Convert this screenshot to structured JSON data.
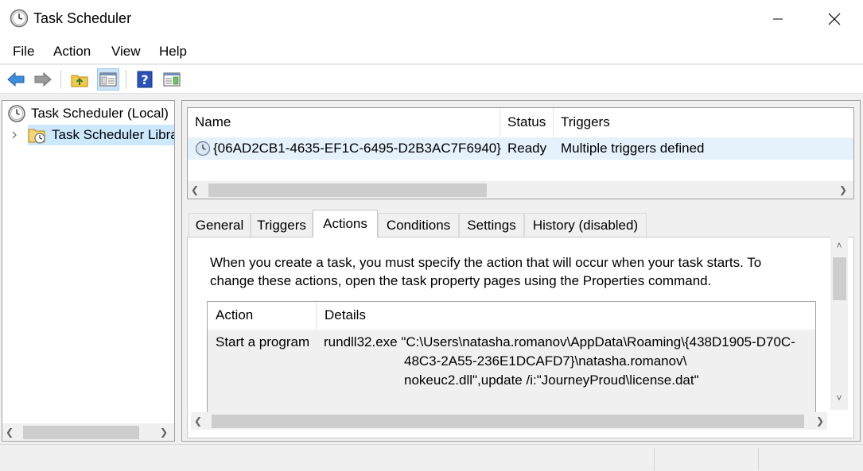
{
  "window": {
    "title": "Task Scheduler"
  },
  "menu": [
    "File",
    "Action",
    "View",
    "Help"
  ],
  "toolbar": {
    "icons": [
      "back-arrow-icon",
      "forward-arrow-icon",
      "folder-up-icon",
      "show-hide-console-tree-icon",
      "help-icon",
      "show-hide-action-pane-icon"
    ]
  },
  "tree": {
    "root": "Task Scheduler (Local)",
    "library": "Task Scheduler Library"
  },
  "task_list": {
    "columns": [
      "Name",
      "Status",
      "Triggers"
    ],
    "rows": [
      {
        "name": "{06AD2CB1-4635-EF1C-6495-D2B3AC7F6940}",
        "status": "Ready",
        "triggers": "Multiple triggers defined"
      }
    ]
  },
  "tabs": [
    "General",
    "Triggers",
    "Actions",
    "Conditions",
    "Settings",
    "History (disabled)"
  ],
  "active_tab": "Actions",
  "actions_tab": {
    "description_line1": "When you create a task, you must specify the action that will occur when your task starts.  To",
    "description_line2": "change  these  actions, open the task property pages using the Properties command.",
    "columns": [
      "Action",
      "Details"
    ],
    "rows": [
      {
        "action": "Start a program",
        "details_line1": "rundll32.exe \"C:\\Users\\natasha.romanov\\AppData\\Roaming\\{438D1905-D70C-",
        "details_line2": "48C3-2A55-236E1DCAFD7}\\natasha.romanov\\",
        "details_line3": "nokeuc2.dll\",update /i:\"JourneyProud\\license.dat\""
      }
    ]
  },
  "colors": {
    "selection": "#cce8ff",
    "row_highlight": "#e5f1fb",
    "accent": "#0078d7"
  }
}
